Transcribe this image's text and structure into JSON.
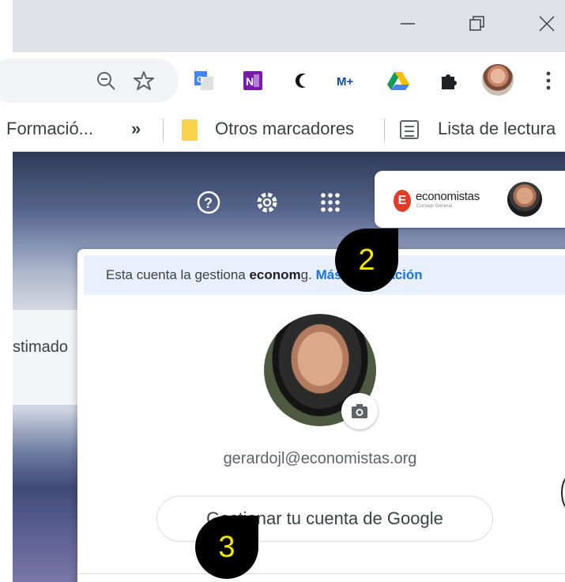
{
  "window": {
    "controls": [
      {
        "name": "minimize",
        "icon": "minimize-icon"
      },
      {
        "name": "restore",
        "icon": "restore-icon"
      },
      {
        "name": "close",
        "icon": "close-icon"
      }
    ]
  },
  "toolbar": {
    "icons": [
      "zoom-out-icon",
      "star-bookmark-icon",
      "google-translate-icon",
      "onenote-icon",
      "dark-mode-moon-icon",
      "movistar-plus-icon",
      "google-drive-icon",
      "extensions-puzzle-icon",
      "profile-avatar",
      "more-menu-icon"
    ],
    "movistar_label": "M+",
    "onenote_label": "N"
  },
  "bookmarks": {
    "truncated_item": "Formació...",
    "overflow": "»",
    "other_bookmarks": "Otros marcadores",
    "reading_list": "Lista de lectura"
  },
  "page": {
    "partial_text": "stimado"
  },
  "header": {
    "icons": [
      "help-icon",
      "settings-gear-icon",
      "apps-grid-icon"
    ],
    "org_logo_letter": "E",
    "org_name": "economistas",
    "org_subtitle": "Consejo General"
  },
  "account_popup": {
    "managed_prefix": "Esta cuenta la gestiona ",
    "managed_org": "econom",
    "managed_suffix": "g. ",
    "more_info": "Más información",
    "email": "gerardojl@economistas.org",
    "manage_account": "Gestionar tu cuenta de Google"
  },
  "markers": [
    {
      "label": "2"
    },
    {
      "label": "3"
    }
  ],
  "colors": {
    "titlebar": "#dee1e6",
    "banner": "#e8f0fe",
    "link": "#1a73e8",
    "marker_bg": "#000000",
    "marker_text": "#f7e600",
    "folder": "#fbd24c"
  }
}
